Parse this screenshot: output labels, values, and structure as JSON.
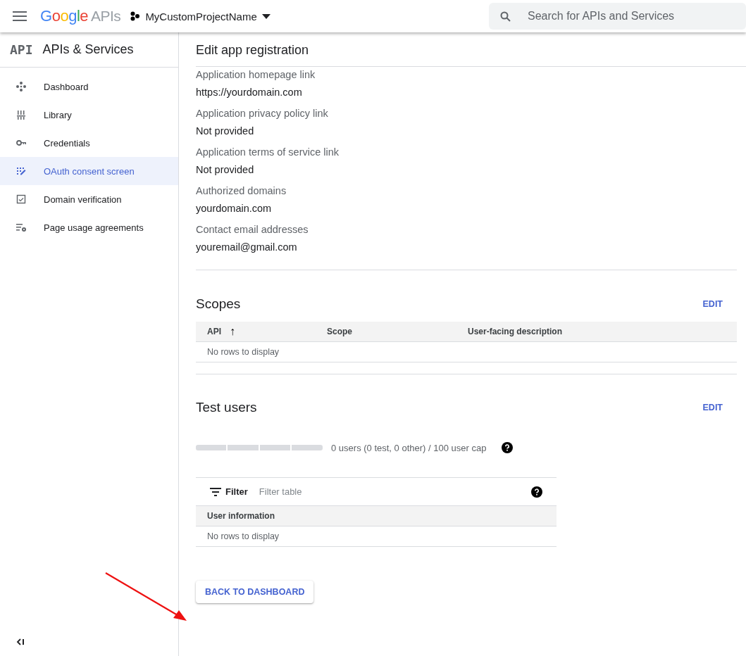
{
  "topbar": {
    "logo": {
      "word": "Google",
      "suffix": "APIs"
    },
    "project": "MyCustomProjectName",
    "search": {
      "placeholder": "Search for APIs and Services"
    }
  },
  "sidebar": {
    "badge": "API",
    "title": "APIs & Services",
    "items": [
      {
        "label": "Dashboard",
        "selected": false
      },
      {
        "label": "Library",
        "selected": false
      },
      {
        "label": "Credentials",
        "selected": false
      },
      {
        "label": "OAuth consent screen",
        "selected": true
      },
      {
        "label": "Domain verification",
        "selected": false
      },
      {
        "label": "Page usage agreements",
        "selected": false
      }
    ]
  },
  "page": {
    "title": "Edit app registration",
    "fields": [
      {
        "label": "Application homepage link",
        "value": "https://yourdomain.com"
      },
      {
        "label": "Application privacy policy link",
        "value": "Not provided"
      },
      {
        "label": "Application terms of service link",
        "value": "Not provided"
      },
      {
        "label": "Authorized domains",
        "value": "yourdomain.com"
      },
      {
        "label": "Contact email addresses",
        "value": "youremail@gmail.com"
      }
    ],
    "scopes": {
      "title": "Scopes",
      "edit": "EDIT",
      "columns": [
        "API",
        "Scope",
        "User-facing description"
      ],
      "sort_arrow": "↑",
      "empty": "No rows to display"
    },
    "test_users": {
      "title": "Test users",
      "edit": "EDIT",
      "level": 0,
      "summary": "0 users (0 test, 0 other) / 100 user cap",
      "filter": {
        "label": "Filter",
        "placeholder": "Filter table"
      },
      "columns": [
        "User information"
      ],
      "empty": "No rows to display"
    },
    "back_button": "BACK TO DASHBOARD"
  }
}
